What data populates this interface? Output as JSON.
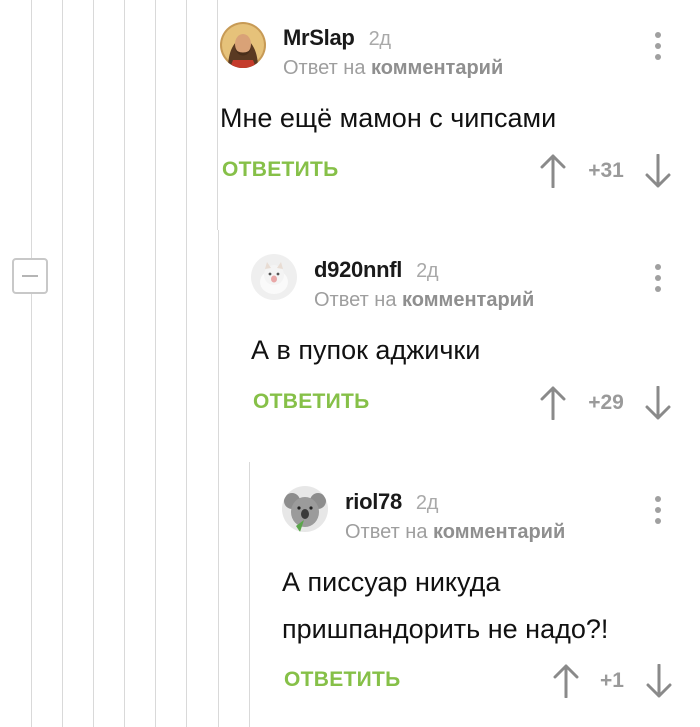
{
  "comments": [
    {
      "author": "MrSlap",
      "time": "2д",
      "reply_prefix": "Ответ на",
      "reply_target": "комментарий",
      "text_lines": [
        "Мне ещё мамон с чипсами"
      ],
      "reply_label": "ОТВЕТИТЬ",
      "rating": "+31",
      "avatar_icon": "avatar-jesus-icon"
    },
    {
      "author": "d920nnfl",
      "time": "2д",
      "reply_prefix": "Ответ на",
      "reply_target": "комментарий",
      "text_lines": [
        "А в пупок аджички"
      ],
      "reply_label": "ОТВЕТИТЬ",
      "rating": "+29",
      "avatar_icon": "avatar-kitten-icon"
    },
    {
      "author": "riol78",
      "time": "2д",
      "reply_prefix": "Ответ на",
      "reply_target": "комментарий",
      "text_lines": [
        "А писсуар никуда",
        "пришпандорить не надо?!"
      ],
      "reply_label": "ОТВЕТИТЬ",
      "rating": "+1",
      "avatar_icon": "avatar-koala-icon"
    }
  ],
  "colors": {
    "accent": "#86c048",
    "muted": "#9e9e9e",
    "thread_line": "#d9d9d9"
  }
}
